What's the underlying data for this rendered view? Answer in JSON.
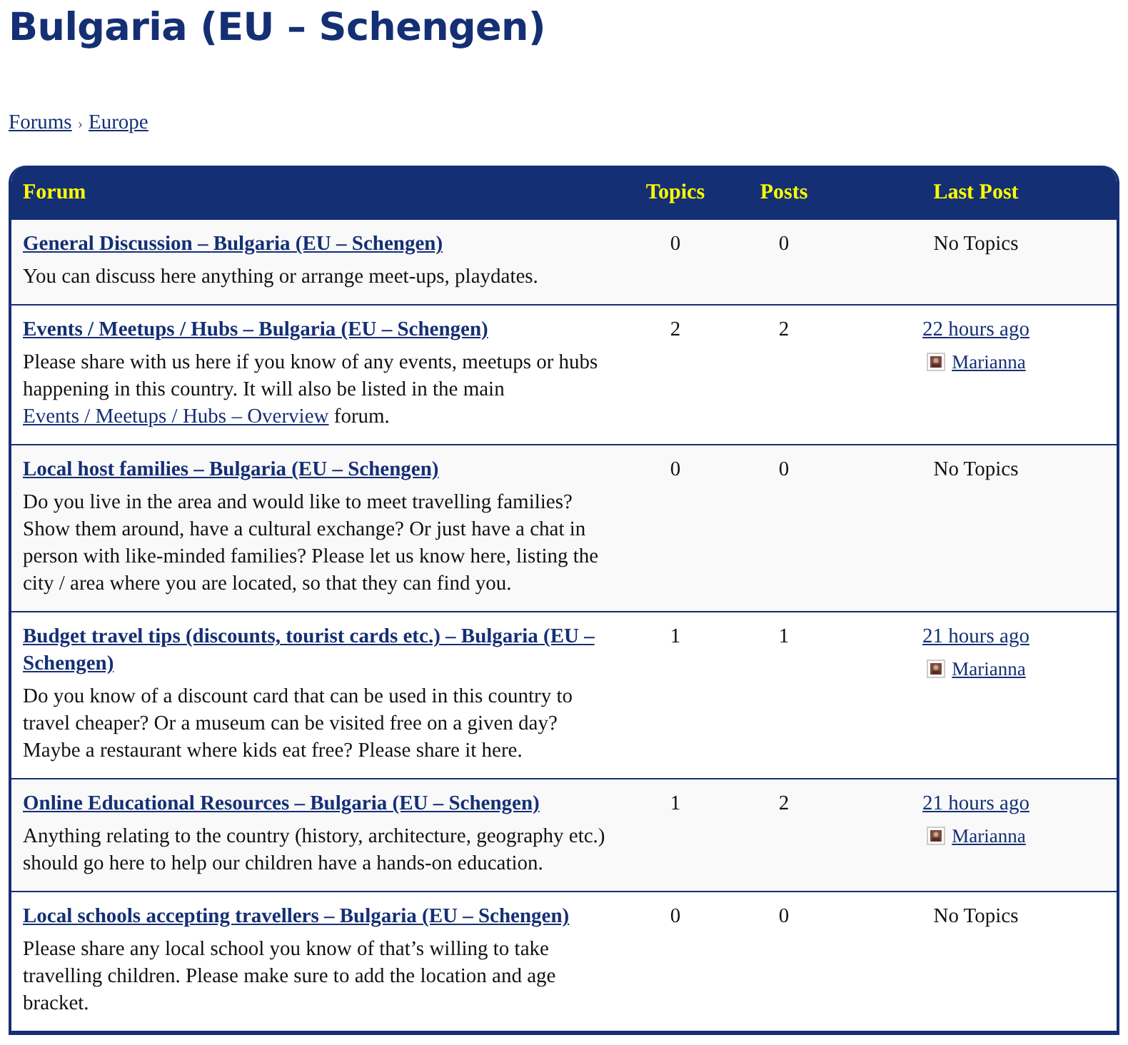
{
  "title": "Bulgaria (EU – Schengen)",
  "breadcrumb": [
    {
      "label": "Forums"
    },
    {
      "label": "Europe"
    }
  ],
  "breadcrumb_separator": "›",
  "table": {
    "columns": [
      "Forum",
      "Topics",
      "Posts",
      "Last Post"
    ],
    "rows": [
      {
        "title": "General Discussion – Bulgaria (EU – Schengen)",
        "description": [
          {
            "kind": "text",
            "text": "You can discuss here anything or arrange meet-ups, playdates."
          }
        ],
        "topics": "0",
        "posts": "0",
        "last_post": {
          "kind": "none",
          "text": "No Topics"
        }
      },
      {
        "title": "Events / Meetups / Hubs – Bulgaria (EU – Schengen)",
        "description": [
          {
            "kind": "text",
            "text": "Please share with us here if you know of any events, meetups or hubs happening in this country. It will also be listed in the main "
          },
          {
            "kind": "link",
            "text": "Events / Meetups / Hubs – Overview"
          },
          {
            "kind": "text",
            "text": " forum."
          }
        ],
        "topics": "2",
        "posts": "2",
        "last_post": {
          "kind": "post",
          "time": "22 hours ago",
          "author": "Marianna"
        }
      },
      {
        "title": "Local host families – Bulgaria (EU – Schengen)",
        "description": [
          {
            "kind": "text",
            "text": "Do you live in the area and would like to meet travelling families? Show them around, have a cultural exchange? Or just have a chat in person with like-minded families? Please let us know here, listing the city / area where you are located, so that they can find you."
          }
        ],
        "topics": "0",
        "posts": "0",
        "last_post": {
          "kind": "none",
          "text": "No Topics"
        }
      },
      {
        "title": "Budget travel tips (discounts, tourist cards etc.) – Bulgaria (EU – Schengen)",
        "description": [
          {
            "kind": "text",
            "text": "Do you know of a discount card that can be used in this country to travel cheaper? Or a museum can be visited free on a given day? Maybe a restaurant where kids eat free? Please share it here."
          }
        ],
        "topics": "1",
        "posts": "1",
        "last_post": {
          "kind": "post",
          "time": "21 hours ago",
          "author": "Marianna"
        }
      },
      {
        "title": "Online Educational Resources – Bulgaria (EU – Schengen)",
        "description": [
          {
            "kind": "text",
            "text": "Anything relating to the country (history, architecture, geography etc.) should go here to help our children have a hands-on education."
          }
        ],
        "topics": "1",
        "posts": "2",
        "last_post": {
          "kind": "post",
          "time": "21 hours ago",
          "author": "Marianna"
        }
      },
      {
        "title": "Local schools accepting travellers – Bulgaria (EU – Schengen)",
        "description": [
          {
            "kind": "text",
            "text": "Please share any local school you know of that’s willing to take travelling children. Please make sure to add the location and age bracket."
          }
        ],
        "topics": "0",
        "posts": "0",
        "last_post": {
          "kind": "none",
          "text": "No Topics"
        }
      }
    ]
  }
}
